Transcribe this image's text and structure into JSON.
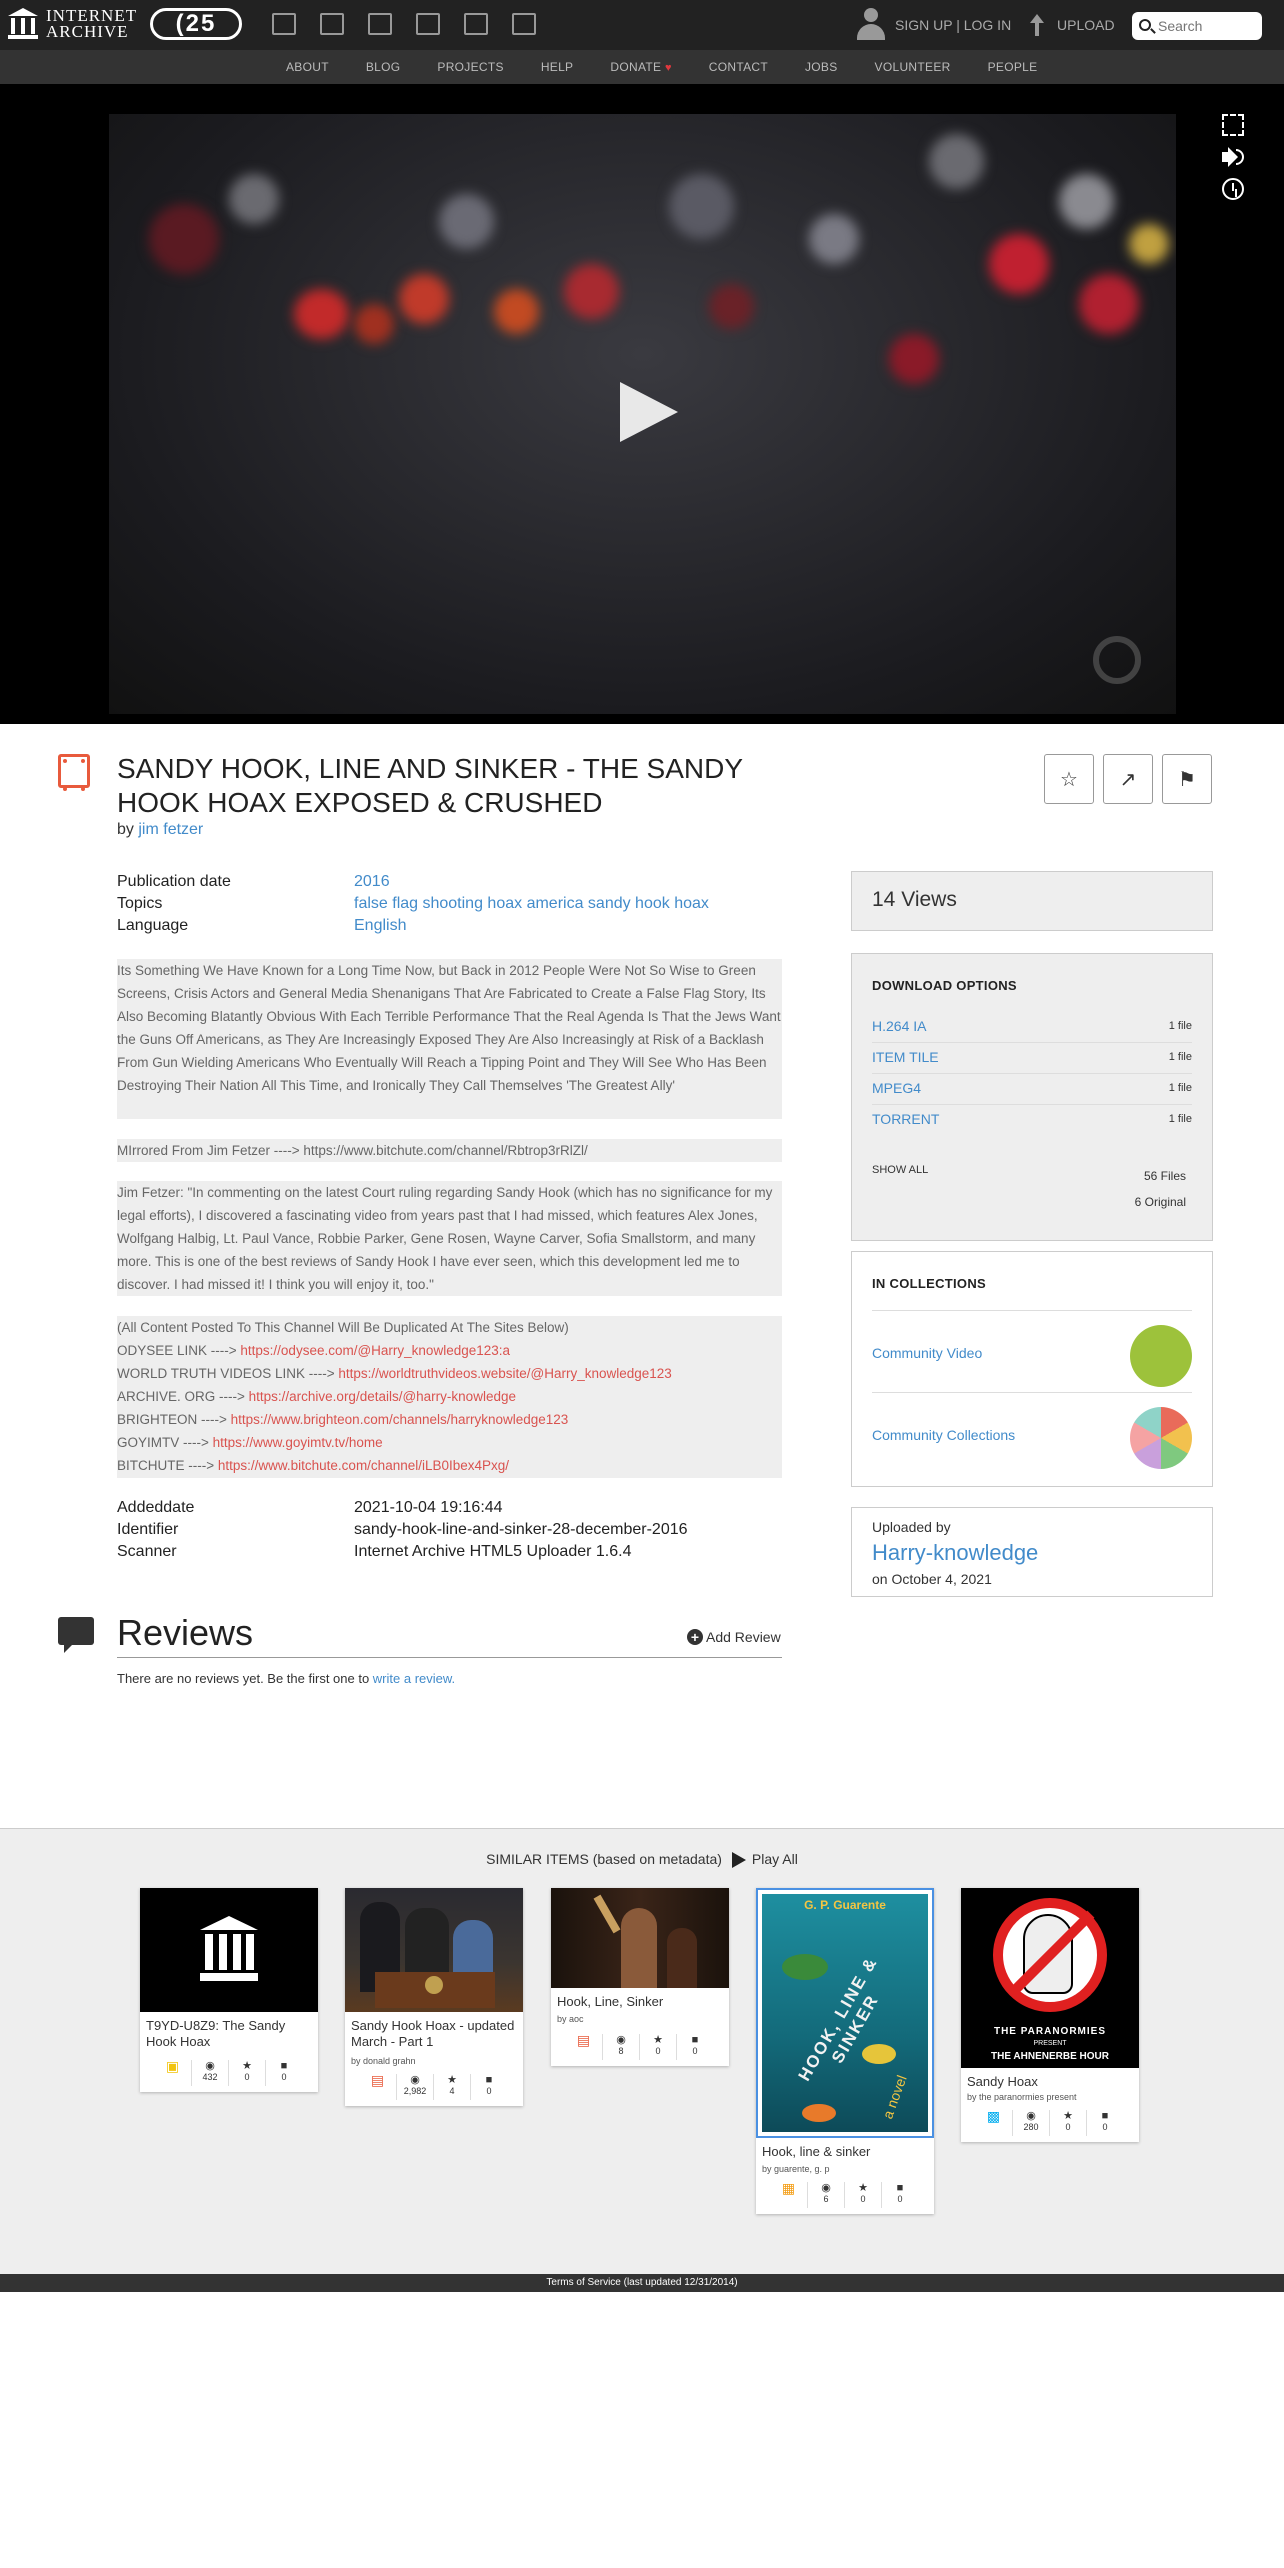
{
  "header": {
    "logo_line1": "INTERNET",
    "logo_line2": "ARCHIVE",
    "anniversary": "(25",
    "signup": "SIGN UP | LOG IN",
    "upload": "UPLOAD",
    "search_placeholder": "Search"
  },
  "nav": [
    "ABOUT",
    "BLOG",
    "PROJECTS",
    "HELP",
    "DONATE",
    "CONTACT",
    "JOBS",
    "VOLUNTEER",
    "PEOPLE"
  ],
  "item": {
    "title": "SANDY HOOK, LINE AND SINKER - THE SANDY HOOK HOAX EXPOSED & CRUSHED",
    "by_prefix": "by",
    "creator": "jim fetzer",
    "publication_date_label": "Publication date",
    "publication_date": "2016",
    "topics_label": "Topics",
    "topics": "false flag shooting hoax america sandy hook hoax",
    "language_label": "Language",
    "language": "English",
    "description": [
      "Its Something We Have Known for a Long Time Now, but Back in 2012 People Were Not So Wise to Green Screens, Crisis Actors and General Media Shenanigans That Are Fabricated to Create a False Flag Story, Its Also Becoming Blatantly Obvious With Each Terrible Performance That the Real Agenda Is That the Jews Want the Guns Off Americans, as They Are Increasingly Exposed They Are Also Increasingly at Risk of a Backlash From Gun Wielding Americans Who Eventually Will Reach a Tipping Point and They Will See Who Has Been Destroying Their Nation All This Time, and Ironically They Call Themselves 'The Greatest Ally'",
      "MIrrored From Jim Fetzer ----> https://www.bitchute.com/channel/Rbtrop3rRlZl/",
      "Jim Fetzer: \"In commenting on the latest Court ruling regarding Sandy Hook (which has no significance for my legal efforts), I discovered a fascinating video from years past that I had missed, which features Alex Jones, Wolfgang Halbig, Lt. Paul Vance, Robbie Parker, Gene Rosen, Wayne Carver, Sofia Smallstorm, and many more. This is one of the best reviews of Sandy Hook I have ever seen, which this development led me to discover. I had missed it! I think you will enjoy it, too.\""
    ],
    "links_intro": "(All Content Posted To This Channel Will Be Duplicated At The Sites Below)",
    "links": [
      {
        "label": "ODYSEE LINK ----> ",
        "url": "https://odysee.com/@Harry_knowledge123:a"
      },
      {
        "label": "WORLD TRUTH VIDEOS LINK ----> ",
        "url": "https://worldtruthvideos.website/@Harry_knowledge123"
      },
      {
        "label": "ARCHIVE. ORG ----> ",
        "url": "https://archive.org/details/@harry-knowledge"
      },
      {
        "label": "BRIGHTEON ----> ",
        "url": "https://www.brighteon.com/channels/harryknowledge123"
      },
      {
        "label": "GOYIMTV ----> ",
        "url": "https://www.goyimtv.tv/home"
      },
      {
        "label": "BITCHUTE ----> ",
        "url": "https://www.bitchute.com/channel/iLB0Ibex4Pxg/"
      }
    ],
    "addeddate_label": "Addeddate",
    "addeddate": "2021-10-04 19:16:44",
    "identifier_label": "Identifier",
    "identifier": "sandy-hook-line-and-sinker-28-december-2016",
    "scanner_label": "Scanner",
    "scanner": "Internet Archive HTML5 Uploader 1.6.4"
  },
  "sidebar": {
    "views": "14 Views",
    "download_title": "DOWNLOAD OPTIONS",
    "downloads": [
      {
        "name": "H.264 IA",
        "count": "1 file"
      },
      {
        "name": "ITEM TILE",
        "count": "1 file"
      },
      {
        "name": "MPEG4",
        "count": "1 file"
      },
      {
        "name": "TORRENT",
        "count": "1 file"
      }
    ],
    "show_all": "SHOW ALL",
    "files_total": "56 Files",
    "files_original": "6 Original",
    "collections_title": "IN COLLECTIONS",
    "collections": [
      "Community Video",
      "Community Collections"
    ],
    "uploaded_by_label": "Uploaded by",
    "uploader": "Harry-knowledge",
    "uploaded_on": "on October 4, 2021"
  },
  "reviews": {
    "title": "Reviews",
    "add": "Add Review",
    "empty_prefix": "There are no reviews yet. Be the first one to ",
    "empty_link": "write a review."
  },
  "similar": {
    "heading": "SIMILAR ITEMS (based on metadata)",
    "play_all": "Play All",
    "items": [
      {
        "title": "T9YD-U8Z9: The Sandy Hook Hoax",
        "by": "",
        "views": "432",
        "favs": "0",
        "reviews": "0",
        "media": "texts"
      },
      {
        "title": "Sandy Hook Hoax - updated March - Part 1",
        "by": "by donald grahn",
        "views": "2,982",
        "favs": "4",
        "reviews": "0",
        "media": "movies"
      },
      {
        "title": "Hook, Line, Sinker",
        "by": "by aoc",
        "views": "8",
        "favs": "0",
        "reviews": "0",
        "media": "movies"
      },
      {
        "title": "Hook, line & sinker",
        "by": "by guarente, g. p",
        "views": "6",
        "favs": "0",
        "reviews": "0",
        "media": "texts",
        "cover_author": "G. P. Guarente",
        "cover_title": "HOOK, LINE & SINKER",
        "cover_sub": "a novel"
      },
      {
        "title": "Sandy Hoax",
        "by": "by the paranormies present",
        "views": "280",
        "favs": "0",
        "reviews": "0",
        "media": "audio",
        "cover_top": "THE PARANORMIES",
        "cover_mid": "PRESENT",
        "cover_bottom": "THE AHNENERBE HOUR"
      }
    ]
  },
  "footer": "Terms of Service (last updated 12/31/2014)"
}
